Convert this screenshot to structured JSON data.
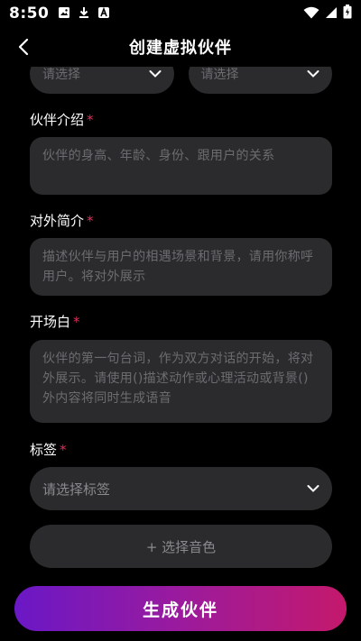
{
  "status_bar": {
    "time": "8:50",
    "left_icons": [
      "image-icon",
      "download-icon",
      "app-icon"
    ],
    "right_icons": [
      "wifi-icon",
      "signal-icon",
      "battery-icon"
    ]
  },
  "header": {
    "title": "创建虚拟伙伴",
    "back_icon": "chevron-left-icon"
  },
  "top_selects": [
    {
      "placeholder": "请选择"
    },
    {
      "placeholder": "请选择"
    }
  ],
  "fields": {
    "intro": {
      "label": "伙伴介绍",
      "required_mark": "*",
      "placeholder": "伙伴的身高、年龄、身份、跟用户的关系"
    },
    "public_intro": {
      "label": "对外简介",
      "required_mark": "*",
      "placeholder": "描述伙伴与用户的相遇场景和背景，请用你称呼用户。将对外展示"
    },
    "opening": {
      "label": "开场白",
      "required_mark": "*",
      "placeholder": "伙伴的第一句台词，作为双方对话的开始，将对外展示。请使用()描述动作或心理活动或背景()外内容将同时生成语音"
    },
    "tags": {
      "label": "标签",
      "required_mark": "*",
      "placeholder": "请选择标签"
    }
  },
  "voice_button": {
    "label": "+ 选择音色"
  },
  "generate_button": {
    "label": "生成伙伴"
  },
  "colors": {
    "background": "#000000",
    "field_bg": "#2b2b2d",
    "placeholder": "#6c6c70",
    "required": "#e0305a",
    "gradient_start": "#6a18c6",
    "gradient_end": "#c4196c"
  }
}
